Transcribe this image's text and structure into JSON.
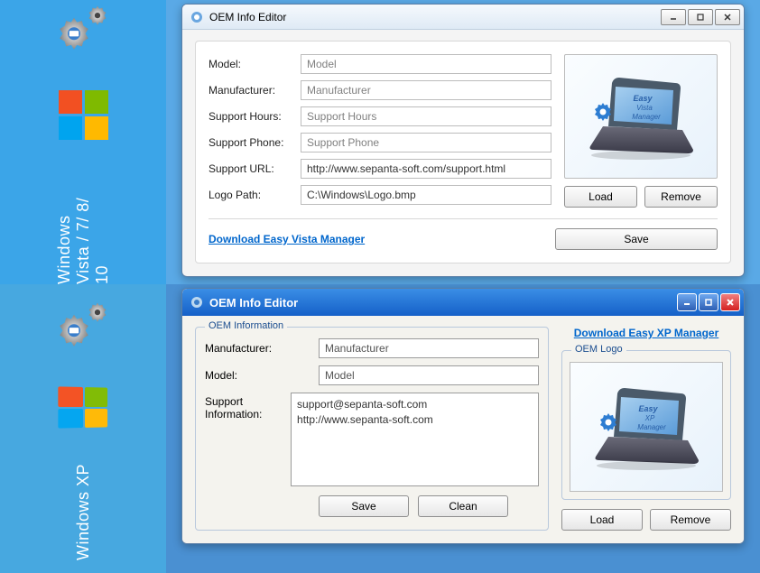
{
  "vista": {
    "sidebar_label": "Windows Vista / 7/ 8/ 10",
    "window_title": "OEM Info Editor",
    "fields": {
      "model": {
        "label": "Model:",
        "value": "Model"
      },
      "manufacturer": {
        "label": "Manufacturer:",
        "value": "Manufacturer"
      },
      "support_hours": {
        "label": "Support Hours:",
        "value": "Support Hours"
      },
      "support_phone": {
        "label": "Support Phone:",
        "value": "Support Phone"
      },
      "support_url": {
        "label": "Support URL:",
        "value": "http://www.sepanta-soft.com/support.html"
      },
      "logo_path": {
        "label": "Logo Path:",
        "value": "C:\\Windows\\Logo.bmp"
      }
    },
    "buttons": {
      "load": "Load",
      "remove": "Remove",
      "save": "Save"
    },
    "download_link": "Download Easy Vista Manager",
    "logo_caption": "Easy Vista Manager"
  },
  "xp": {
    "sidebar_label": "Windows  XP",
    "window_title": "OEM Info Editor",
    "group_info": "OEM Information",
    "group_logo": "OEM Logo",
    "fields": {
      "manufacturer": {
        "label": "Manufacturer:",
        "value": "Manufacturer"
      },
      "model": {
        "label": "Model:",
        "value": "Model"
      },
      "support_info": {
        "label": "Support Information:",
        "value": "support@sepanta-soft.com\nhttp://www.sepanta-soft.com"
      }
    },
    "buttons": {
      "save": "Save",
      "clean": "Clean",
      "load": "Load",
      "remove": "Remove"
    },
    "download_link": "Download Easy XP Manager",
    "logo_caption": "Easy XP Manager"
  }
}
